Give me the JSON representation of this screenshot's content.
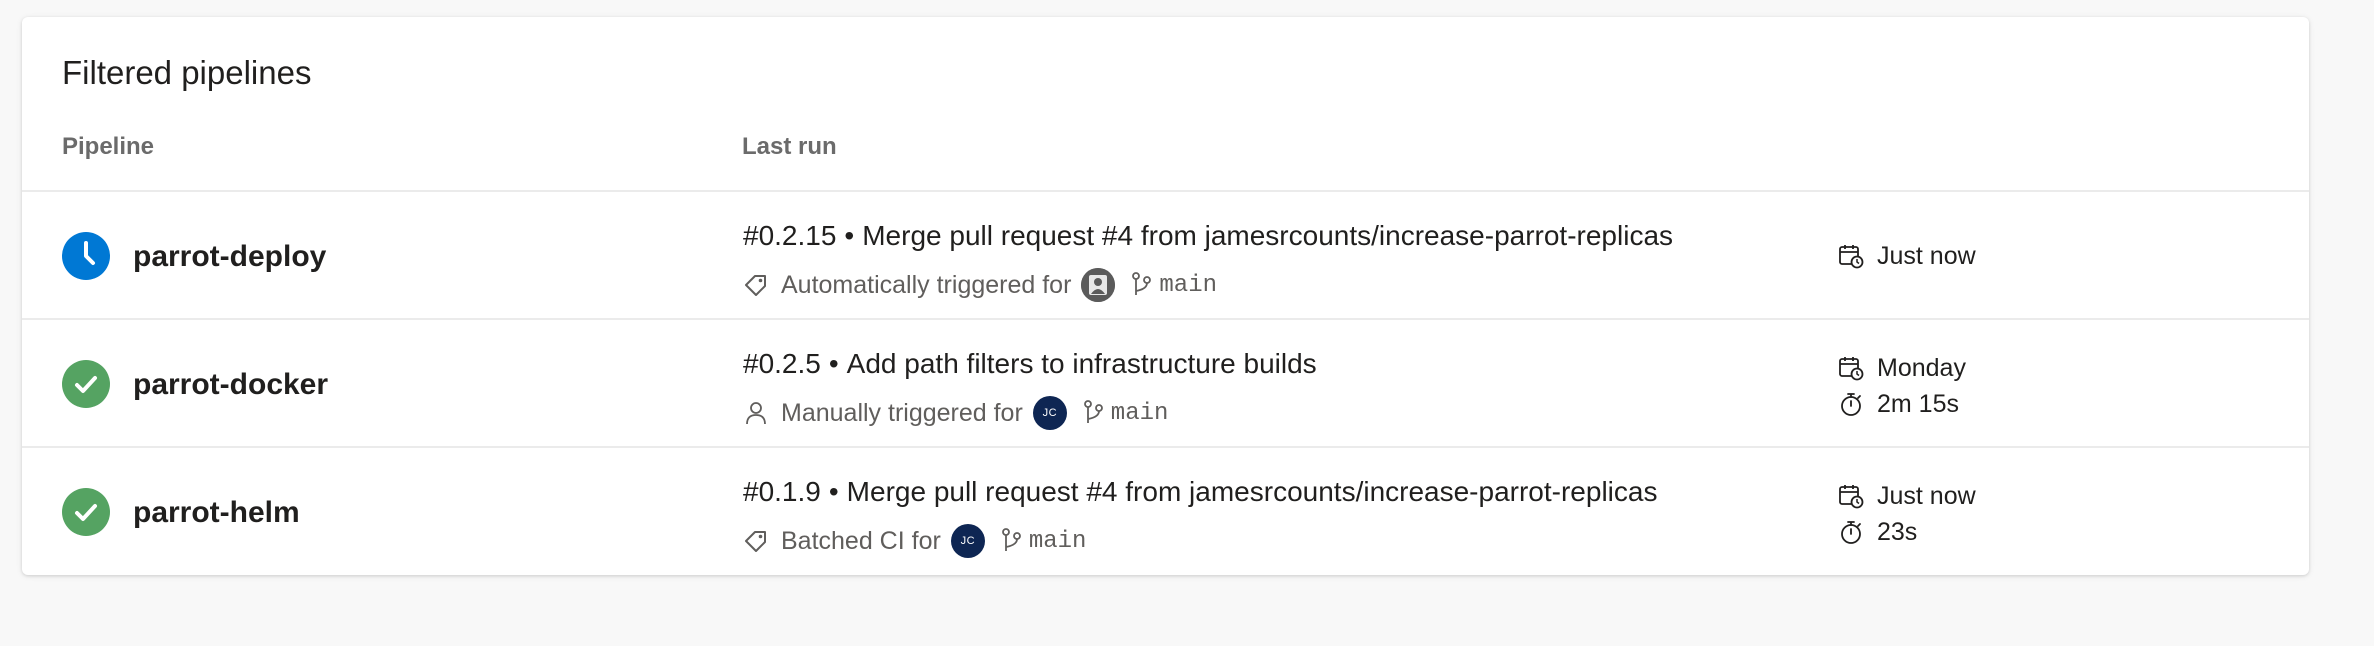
{
  "card": {
    "title": "Filtered pipelines",
    "columns": {
      "pipeline": "Pipeline",
      "last_run": "Last run"
    }
  },
  "colors": {
    "running": "#0078d4",
    "succeeded": "#55a362",
    "avatar_initials_bg": "#0e2653"
  },
  "pipelines": [
    {
      "name": "parrot-deploy",
      "status": "running",
      "status_icon": "clock-icon",
      "run_number": "#0.2.15",
      "bullet": "•",
      "commit_message": "Merge pull request #4 from jamesrcounts/increase-parrot-replicas",
      "trigger_icon": "tag-icon",
      "trigger_text": "Automatically triggered for",
      "avatar": {
        "type": "photo",
        "initials": ""
      },
      "branch": "main",
      "when": "Just now",
      "duration": ""
    },
    {
      "name": "parrot-docker",
      "status": "succeeded",
      "status_icon": "checkmark-icon",
      "run_number": "#0.2.5",
      "bullet": "•",
      "commit_message": "Add path filters to infrastructure builds",
      "trigger_icon": "person-icon",
      "trigger_text": "Manually triggered for",
      "avatar": {
        "type": "initials",
        "initials": "JC"
      },
      "branch": "main",
      "when": "Monday",
      "duration": "2m 15s"
    },
    {
      "name": "parrot-helm",
      "status": "succeeded",
      "status_icon": "checkmark-icon",
      "run_number": "#0.1.9",
      "bullet": "•",
      "commit_message": "Merge pull request #4 from jamesrcounts/increase-parrot-replicas",
      "trigger_icon": "tag-icon",
      "trigger_text": "Batched CI for",
      "avatar": {
        "type": "initials",
        "initials": "JC"
      },
      "branch": "main",
      "when": "Just now",
      "duration": "23s"
    }
  ]
}
